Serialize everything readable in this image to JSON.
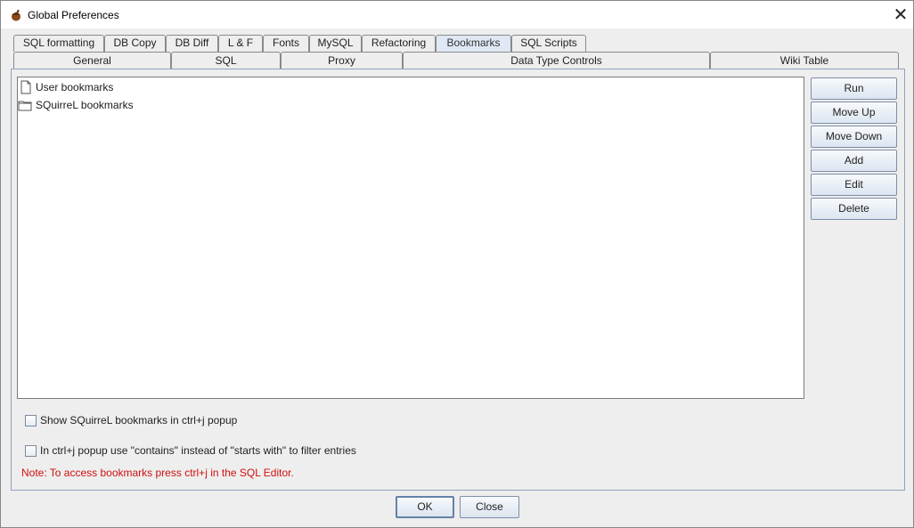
{
  "window": {
    "title": "Global Preferences",
    "icon": "acorn-icon",
    "close_glyph": "✕"
  },
  "tabs_row1": [
    {
      "label": "SQL formatting"
    },
    {
      "label": "DB Copy"
    },
    {
      "label": "DB Diff"
    },
    {
      "label": "L & F"
    },
    {
      "label": "Fonts"
    },
    {
      "label": "MySQL"
    },
    {
      "label": "Refactoring"
    },
    {
      "label": "Bookmarks",
      "selected": true
    },
    {
      "label": "SQL Scripts"
    }
  ],
  "tabs_row2": [
    {
      "label": "General"
    },
    {
      "label": "SQL"
    },
    {
      "label": "Proxy"
    },
    {
      "label": "Data Type Controls"
    },
    {
      "label": "Wiki Table"
    }
  ],
  "tree": {
    "items": [
      {
        "label": "User bookmarks",
        "icon": "document-icon"
      },
      {
        "label": "SQuirreL bookmarks",
        "icon": "folder-icon"
      }
    ]
  },
  "side_buttons": {
    "run": "Run",
    "move_up": "Move Up",
    "move_down": "Move Down",
    "add": "Add",
    "edit": "Edit",
    "delete": "Delete"
  },
  "options": {
    "show_popup": {
      "label": "Show SQuirreL bookmarks in ctrl+j popup",
      "checked": false
    },
    "use_contains": {
      "label": "In ctrl+j popup use \"contains\" instead of \"starts with\" to filter entries",
      "checked": false
    }
  },
  "note": "Note: To access bookmarks press ctrl+j in the SQL Editor.",
  "footer": {
    "ok": "OK",
    "close": "Close"
  },
  "colors": {
    "note_text": "#d01010",
    "selected_tab": "#dfe8f4",
    "panel_border": "#8ea4be"
  }
}
